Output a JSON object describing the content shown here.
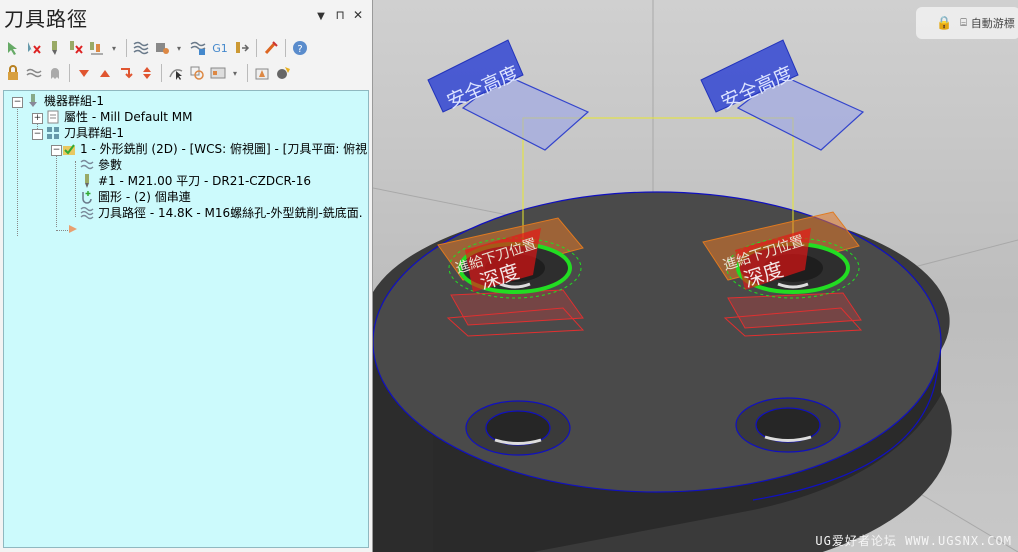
{
  "panel": {
    "title": "刀具路徑",
    "controls": {
      "dropdown": "▼",
      "pin": "⊓",
      "close": "✕"
    }
  },
  "toolbar_row1": [
    "select-forward-icon",
    "delete-icon",
    "tool-icon",
    "tool-delete-icon",
    "tool-group-icon",
    "toolpath-icon",
    "generate-icon",
    "simulate-icon",
    "g1-icon",
    "post-icon",
    "edit-icon",
    "help-icon"
  ],
  "toolbar_row2": [
    "lock-icon",
    "wave-icon",
    "ghost-icon",
    "move-down-icon",
    "move-up-icon",
    "reorder-icon",
    "expand-icon",
    "select-icon",
    "copy-icon",
    "display-icon",
    "settings-icon",
    "material-icon"
  ],
  "tree": {
    "machine_group": "機器群組-1",
    "properties": "屬性 - Mill Default MM",
    "toolpath_group": "刀具群組-1",
    "operation": "1 - 外形銑削 (2D) - [WCS: 俯視圖] - [刀具平面: 俯視",
    "parameters": "參數",
    "tool": "#1 - M21.00 平刀 - DR21-CZDCR-16",
    "geometry": "圖形 - (2) 個串連",
    "toolpath": "刀具路徑 - 14.8K - M16螺絲孔-外型銑削-銑底面."
  },
  "viewport": {
    "lock_label": "自動游標",
    "labels": {
      "safe_height_left": "安全高度",
      "safe_height_right": "安全高度",
      "feed_plane_left": "進給下刀位置",
      "feed_plane_right": "進給下刀位置",
      "depth_left": "深度",
      "depth_right": "深度"
    },
    "watermark": "UG爱好者论坛 WWW.UGSNX.COM"
  },
  "colors": {
    "tree_bg": "#ccfafc",
    "safe_plane": "#3344cc",
    "feed_plane": "#e07a20",
    "depth_plane": "#dd2222",
    "toolpath": "#22dd22",
    "part": "#4a4a4a"
  }
}
